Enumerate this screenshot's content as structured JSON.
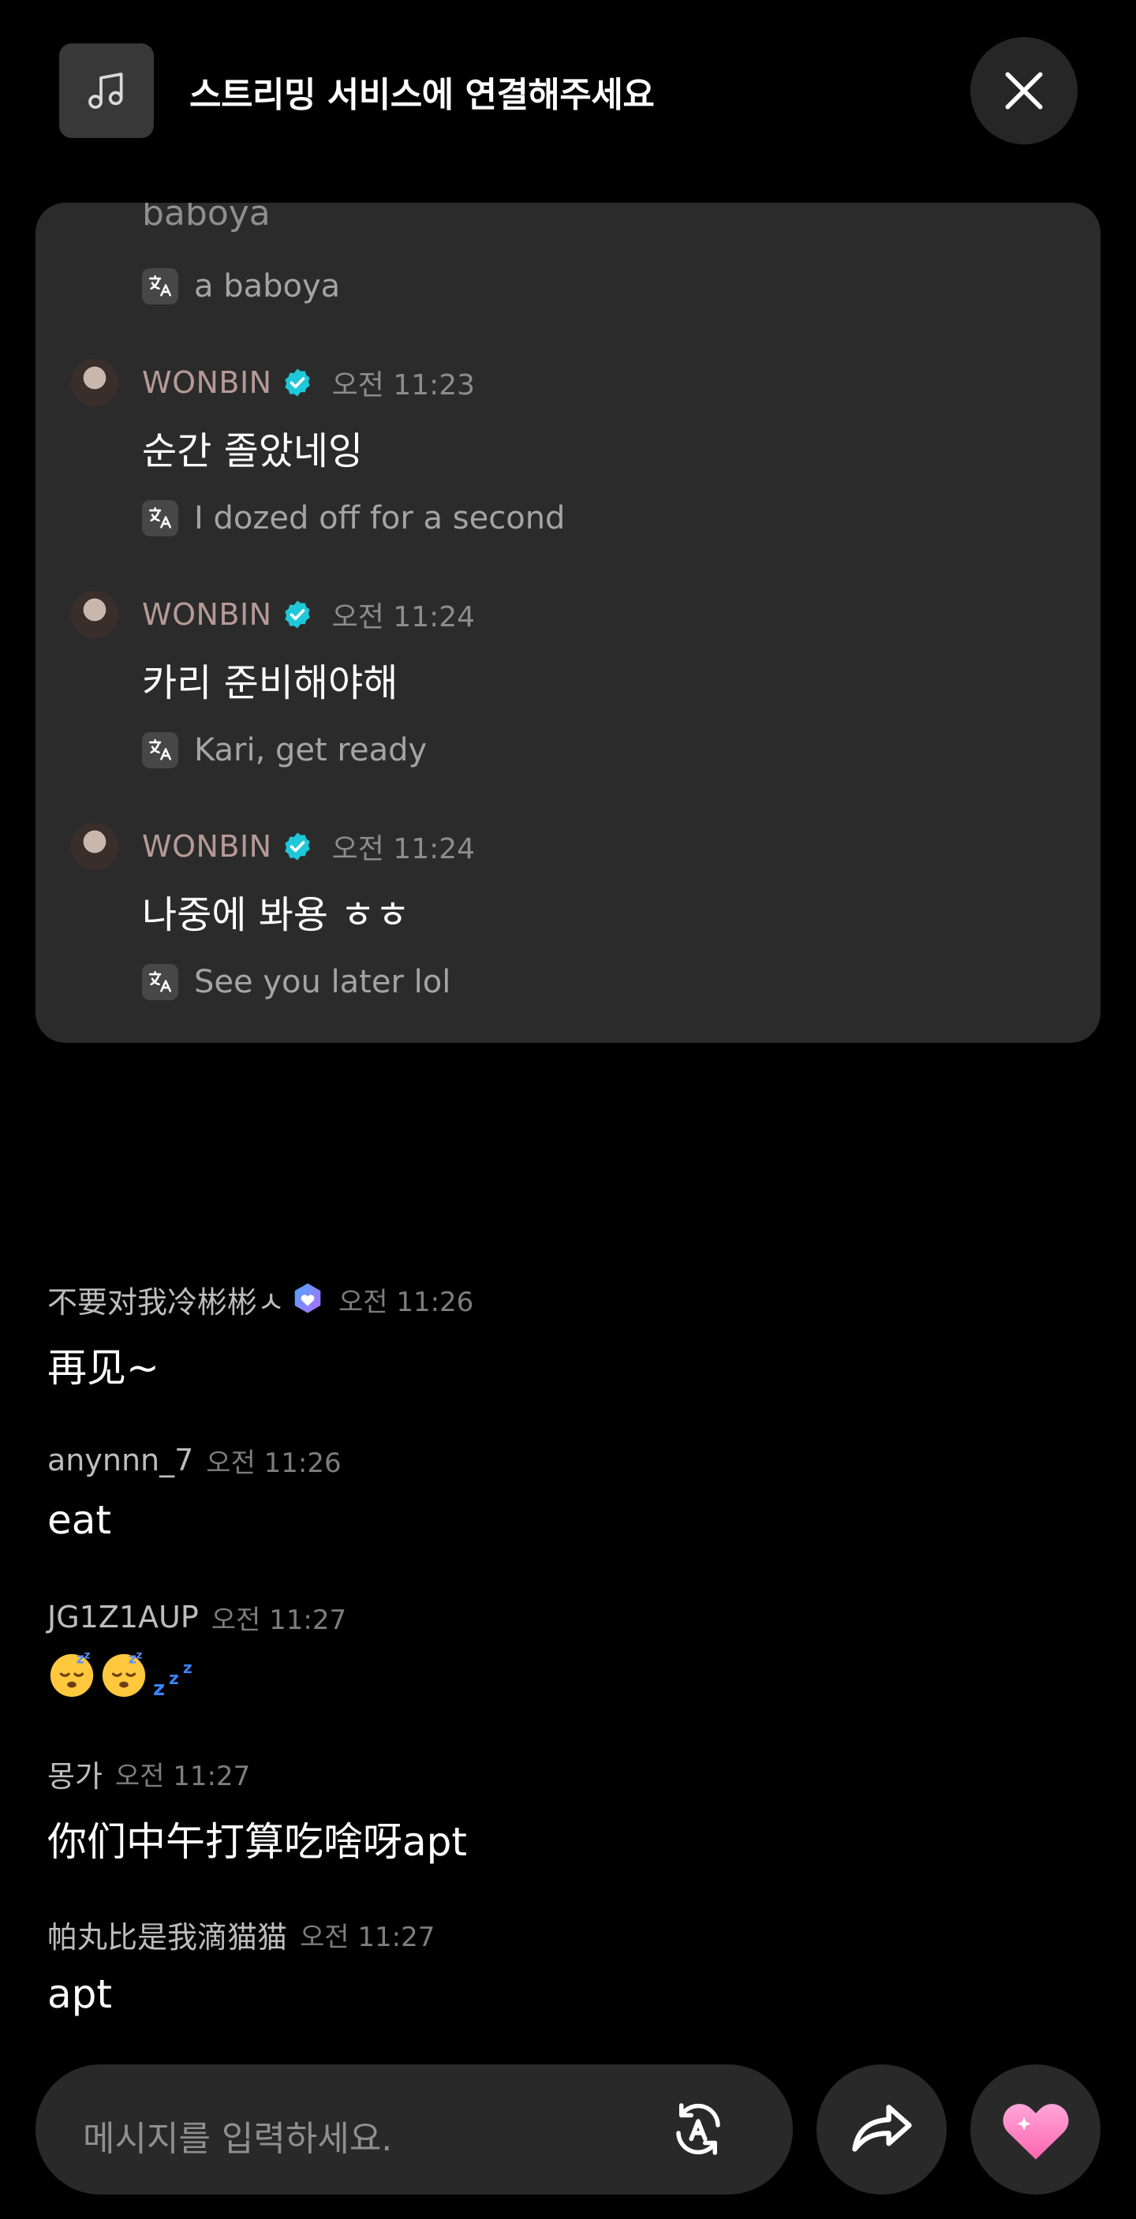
{
  "header": {
    "title": "스트리밍 서비스에 연결해주세요",
    "music_icon": "music-note-icon",
    "close_icon": "close-icon"
  },
  "artist_panel": {
    "cut_off_text": "baboya",
    "cut_off_translation": "a baboya",
    "messages": [
      {
        "name": "WONBIN",
        "time": "오전 11:23",
        "text": "순간 졸았네잉",
        "translation": "I dozed off for a second"
      },
      {
        "name": "WONBIN",
        "time": "오전 11:24",
        "text": "카리 준비해야해",
        "translation": "Kari, get ready"
      },
      {
        "name": "WONBIN",
        "time": "오전 11:24",
        "text": "나중에 봐용 ㅎㅎ",
        "translation": "See you later lol"
      }
    ]
  },
  "chat": [
    {
      "user": "不要对我冷彬彬ㅅ",
      "time": "오전 11:26",
      "text": "再见~",
      "badge": "membership-heart-badge-icon"
    },
    {
      "user": "anynnn_7",
      "time": "오전 11:26",
      "text": "eat"
    },
    {
      "user": "JG1Z1AUP",
      "time": "오전 11:27",
      "emoji": [
        "sleepy-face-emoji",
        "sleepy-face-emoji",
        "zzz-emoji"
      ]
    },
    {
      "user": "몽가",
      "time": "오전 11:27",
      "text": "你们中午打算吃啥呀apt"
    },
    {
      "user": "帕丸比是我滴猫猫",
      "time": "오전 11:27",
      "text": "apt"
    }
  ],
  "composer": {
    "placeholder": "메시지를 입력하세요.",
    "translate_icon": "auto-translate-icon",
    "share_icon": "share-arrow-icon",
    "heart_icon": "heart-sparkle-icon"
  },
  "colors": {
    "background": "#000000",
    "panel": "#2b2b2b",
    "artist_name": "#b69a96",
    "verified": "#1ec8d8",
    "heart": "#ff86c3"
  }
}
